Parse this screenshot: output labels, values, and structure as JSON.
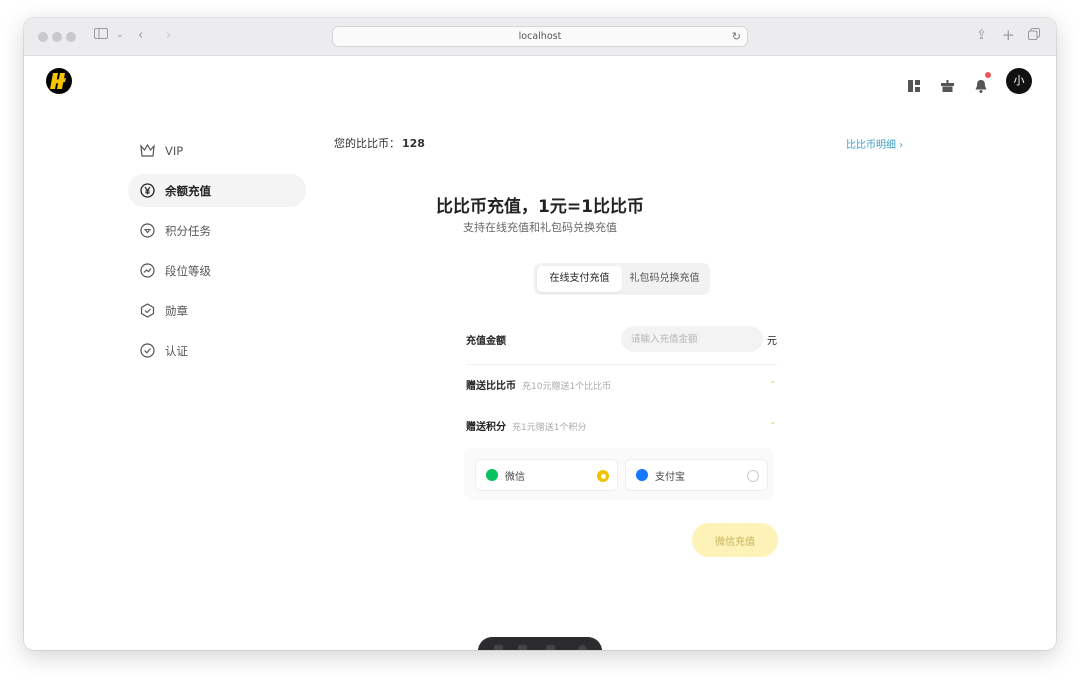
{
  "browser": {
    "address": "localhost"
  },
  "header": {
    "icons": [
      "layout-icon",
      "gift-icon",
      "bell-icon"
    ],
    "avatar_text": "小"
  },
  "sidebar": {
    "items": [
      {
        "label": "VIP",
        "icon": "crown-icon",
        "active": false
      },
      {
        "label": "余额充值",
        "icon": "yen-icon",
        "active": true
      },
      {
        "label": "积分任务",
        "icon": "points-icon",
        "active": false
      },
      {
        "label": "段位等级",
        "icon": "trend-icon",
        "active": false
      },
      {
        "label": "勋章",
        "icon": "medal-icon",
        "active": false
      },
      {
        "label": "认证",
        "icon": "check-circle-icon",
        "active": false
      }
    ]
  },
  "main": {
    "balance_label": "您的比比币：",
    "balance_value": "128",
    "detail_link": "比比币明细 ›",
    "title": "比比币充值，1元=1比比币",
    "subtitle": "支持在线充值和礼包码兑换充值",
    "tabs": [
      {
        "label": "在线支付充值",
        "active": true
      },
      {
        "label": "礼包码兑换充值",
        "active": false
      }
    ],
    "amount": {
      "label": "充值金额",
      "placeholder": "请输入充值金额",
      "unit": "元"
    },
    "bonus_coins": {
      "label": "赠送比比币",
      "hint": "充10元赠送1个比比币",
      "value": "-"
    },
    "bonus_points": {
      "label": "赠送积分",
      "hint": "充1元赠送1个积分",
      "value": "-"
    },
    "payment_methods": [
      {
        "label": "微信",
        "selected": true,
        "color": "#07c160"
      },
      {
        "label": "支付宝",
        "selected": false,
        "color": "#1677ff"
      }
    ],
    "submit_label": "微信充值"
  },
  "colors": {
    "accent": "#f2c200",
    "link": "#3aa0c8"
  }
}
